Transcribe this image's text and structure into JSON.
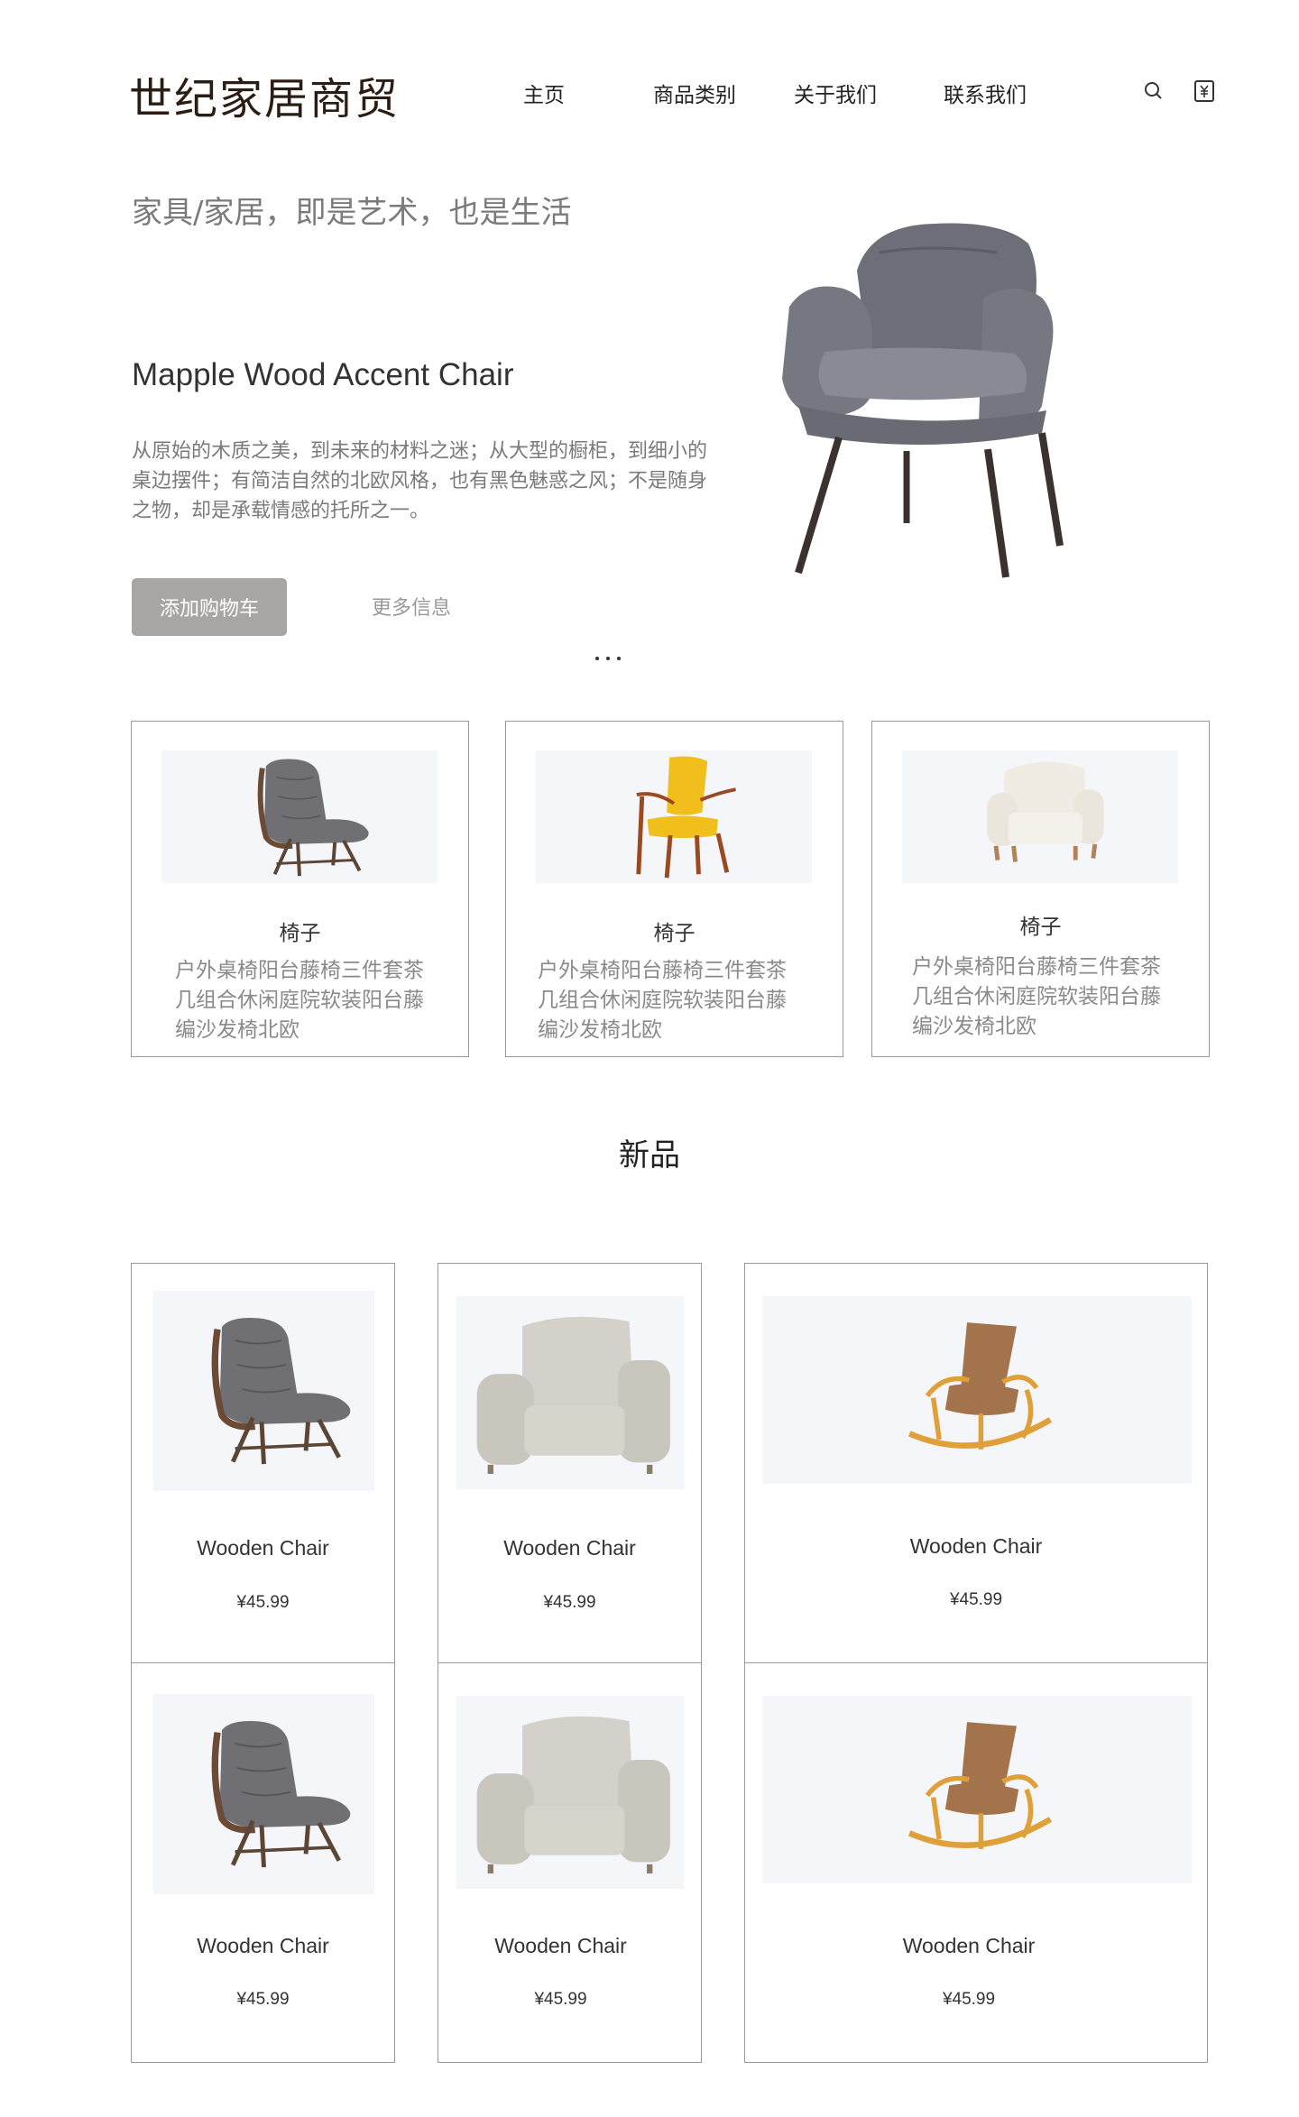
{
  "header": {
    "logo": "世纪家居商贸",
    "nav": [
      {
        "label": "主页"
      },
      {
        "label": "商品类别"
      },
      {
        "label": "关于我们"
      },
      {
        "label": "联系我们"
      }
    ],
    "icons": [
      "search-icon",
      "cart-icon"
    ]
  },
  "hero": {
    "tagline": "家具/家居，即是艺术，也是生活",
    "title": "Mapple Wood Accent Chair",
    "description": "从原始的木质之美，到未来的材料之迷；从大型的橱柜，到细小的桌边摆件；有简洁自然的北欧风格，也有黑色魅惑之风；不是随身之物，却是承载情感的托所之一。",
    "add_to_cart": "添加购物车",
    "more_info": "更多信息"
  },
  "categories": [
    {
      "title": "椅子",
      "desc": "户外桌椅阳台藤椅三件套茶几组合休闲庭院软装阳台藤编沙发椅北欧",
      "image": "gray-lounge-chair"
    },
    {
      "title": "椅子",
      "desc": "户外桌椅阳台藤椅三件套茶几组合休闲庭院软装阳台藤编沙发椅北欧",
      "image": "yellow-wood-armchair"
    },
    {
      "title": "椅子",
      "desc": "户外桌椅阳台藤椅三件套茶几组合休闲庭院软装阳台藤编沙发椅北欧",
      "image": "white-sofa-chair"
    }
  ],
  "new_products": {
    "title": "新品",
    "items": [
      {
        "name": "Wooden Chair",
        "price": "¥45.99",
        "image": "gray-lounge-chair"
      },
      {
        "name": "Wooden Chair",
        "price": "¥45.99",
        "image": "beige-wingback-chair"
      },
      {
        "name": "Wooden Chair",
        "price": "¥45.99",
        "image": "wooden-rocking-chair"
      },
      {
        "name": "Wooden Chair",
        "price": "¥45.99",
        "image": "gray-lounge-chair"
      },
      {
        "name": "Wooden Chair",
        "price": "¥45.99",
        "image": "beige-wingback-chair"
      },
      {
        "name": "Wooden Chair",
        "price": "¥45.99",
        "image": "wooden-rocking-chair"
      }
    ]
  },
  "colors": {
    "button": "#aaa5a5",
    "image_bg": "#f5f6fa",
    "border": "#999999"
  }
}
